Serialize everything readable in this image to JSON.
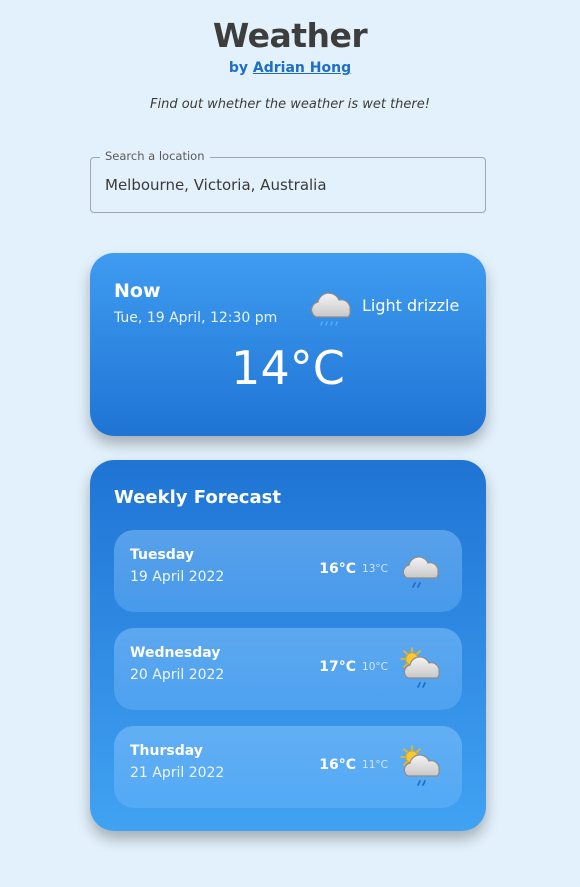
{
  "header": {
    "title": "Weather",
    "by_prefix": "by",
    "author": "Adrian Hong",
    "tagline": "Find out whether the weather is wet there!"
  },
  "search": {
    "label": "Search a location",
    "value": "Melbourne, Victoria, Australia"
  },
  "now": {
    "label": "Now",
    "datetime": "Tue, 19 April, 12:30 pm",
    "condition": "Light drizzle",
    "temperature": "14°C",
    "icon": "cloud-drizzle-icon"
  },
  "forecast": {
    "title": "Weekly Forecast",
    "days": [
      {
        "day": "Tuesday",
        "date": "19 April 2022",
        "max": "16°C",
        "min": "13°C",
        "icon": "cloud-rain-icon"
      },
      {
        "day": "Wednesday",
        "date": "20 April 2022",
        "max": "17°C",
        "min": "10°C",
        "icon": "sun-cloud-rain-icon"
      },
      {
        "day": "Thursday",
        "date": "21 April 2022",
        "max": "16°C",
        "min": "11°C",
        "icon": "sun-cloud-rain-icon"
      }
    ]
  },
  "colors": {
    "background": "#e3f1fc",
    "card_top": "#3f9cf0",
    "card_bottom": "#1f74d4",
    "link": "#1e6ec8"
  }
}
